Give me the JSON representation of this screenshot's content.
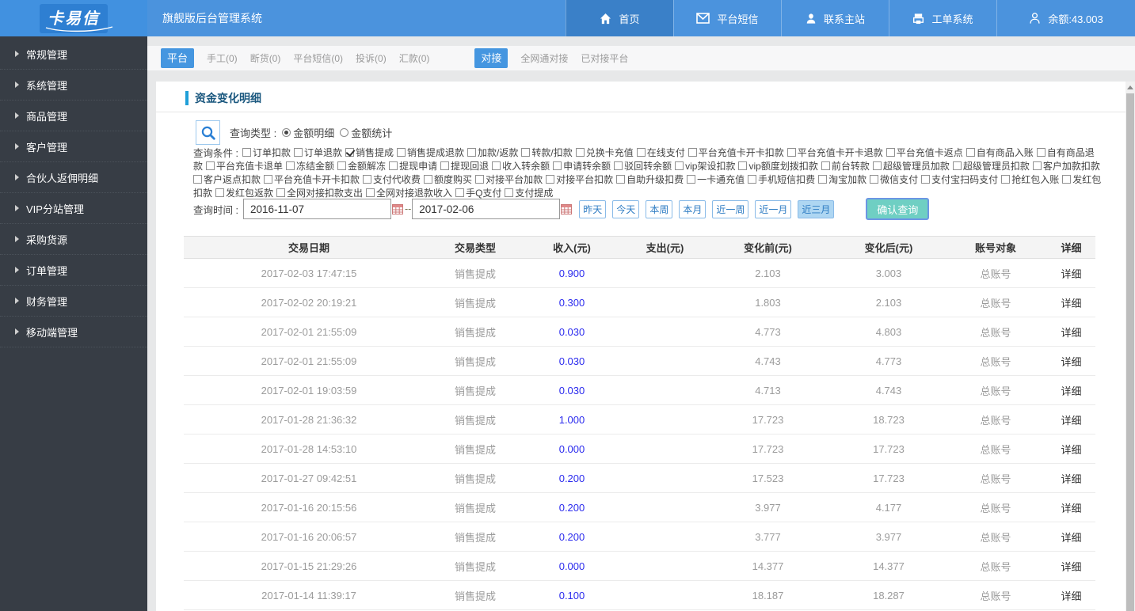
{
  "header": {
    "logo": "卡易信",
    "title": "旗舰版后台管理系统",
    "nav": [
      {
        "label": "首页",
        "icon": "home-icon",
        "active": true
      },
      {
        "label": "平台短信",
        "icon": "sms-icon",
        "active": false
      },
      {
        "label": "联系主站",
        "icon": "contact-icon",
        "active": false
      },
      {
        "label": "工单系统",
        "icon": "ticket-icon",
        "active": false
      },
      {
        "label": "余额:43.003",
        "icon": "user-icon",
        "active": false
      }
    ]
  },
  "sidebar": {
    "items": [
      "常规管理",
      "系统管理",
      "商品管理",
      "客户管理",
      "合伙人返佣明细",
      "VIP分站管理",
      "采购货源",
      "订单管理",
      "财务管理",
      "移动端管理"
    ]
  },
  "subnav": {
    "platform_label": "平台",
    "platform_tabs": [
      "手工(0)",
      "断货(0)",
      "平台短信(0)",
      "投诉(0)",
      "汇款(0)"
    ],
    "connect_label": "对接",
    "connect_tabs": [
      "全网通对接",
      "已对接平台"
    ]
  },
  "content": {
    "title": "资金变化明细",
    "query_type": {
      "label": "查询类型 :",
      "options": [
        {
          "label": "金额明细",
          "selected": true
        },
        {
          "label": "金额统计",
          "selected": false
        }
      ]
    },
    "cond_label": "查询条件 :",
    "filter_lines": [
      [
        {
          "cb": "订单扣款"
        },
        {
          "cb": "订单退款"
        },
        {
          "cb": "销售提成",
          "checked": true
        },
        {
          "cb": "销售提成退款"
        },
        {
          "cb": "加款/返款"
        },
        {
          "cb": "转款/扣款"
        },
        {
          "cb": "兑换卡充值"
        },
        {
          "cb": "在线支付"
        },
        {
          "cb": "平台充值卡开卡扣款"
        },
        {
          "cb": "平台充值卡开卡退款"
        },
        {
          "cb": "平台充值卡返点"
        },
        {
          "cb": "自有商品入账"
        },
        {
          "cb": "自有商品退"
        }
      ],
      [
        {
          "t": "款"
        },
        {
          "cb": "平台充值卡退单"
        },
        {
          "cb": "冻结金额"
        },
        {
          "cb": "金额解冻"
        },
        {
          "cb": "提现申请"
        },
        {
          "cb": "提现回退"
        },
        {
          "cb": "收入转余额"
        },
        {
          "cb": "申请转余额"
        },
        {
          "cb": "驳回转余额"
        },
        {
          "cb": "vip架设扣款"
        },
        {
          "cb": "vip额度划拨扣款"
        },
        {
          "cb": "前台转款"
        },
        {
          "cb": "超级管理员加款"
        },
        {
          "cb": "超级管理员扣款"
        },
        {
          "cb": "客户加款扣款"
        }
      ],
      [
        {
          "cb": "客户返点扣款"
        },
        {
          "cb": "平台充值卡开卡扣款"
        },
        {
          "cb": "支付代收费"
        },
        {
          "cb": "额度购买"
        },
        {
          "cb": "对接平台加款"
        },
        {
          "cb": "对接平台扣款"
        },
        {
          "cb": "自助升级扣费"
        },
        {
          "cb": "一卡通充值"
        },
        {
          "cb": "手机短信扣费"
        },
        {
          "cb": "淘宝加款"
        },
        {
          "cb": "微信支付"
        },
        {
          "cb": "支付宝扫码支付"
        },
        {
          "cb": "抢红包入账"
        },
        {
          "cb": "发红包"
        }
      ],
      [
        {
          "t": "扣款"
        },
        {
          "cb": "发红包返款"
        },
        {
          "cb": "全网对接扣款支出"
        },
        {
          "cb": "全网对接退款收入"
        },
        {
          "cb": "手Q支付"
        },
        {
          "cb": "支付提成"
        }
      ]
    ],
    "time": {
      "label": "查询时间 :",
      "from": "2016-11-07",
      "to": "2017-02-06",
      "separator": "--"
    },
    "quick_buttons": [
      {
        "label": "昨天",
        "active": false
      },
      {
        "label": "今天",
        "active": false
      },
      {
        "label": "本周",
        "active": false
      },
      {
        "label": "本月",
        "active": false
      },
      {
        "label": "近一周",
        "active": false
      },
      {
        "label": "近一月",
        "active": false
      },
      {
        "label": "近三月",
        "active": true
      }
    ],
    "submit_label": "确认查询"
  },
  "table": {
    "headers": [
      "交易日期",
      "交易类型",
      "收入(元)",
      "支出(元)",
      "变化前(元)",
      "变化后(元)",
      "账号对象",
      "详细"
    ],
    "rows": [
      [
        "2017-02-03 17:47:15",
        "销售提成",
        "0.900",
        "",
        "2.103",
        "3.003",
        "总账号",
        "详细"
      ],
      [
        "2017-02-02 20:19:21",
        "销售提成",
        "0.300",
        "",
        "1.803",
        "2.103",
        "总账号",
        "详细"
      ],
      [
        "2017-02-01 21:55:09",
        "销售提成",
        "0.030",
        "",
        "4.773",
        "4.803",
        "总账号",
        "详细"
      ],
      [
        "2017-02-01 21:55:09",
        "销售提成",
        "0.030",
        "",
        "4.743",
        "4.773",
        "总账号",
        "详细"
      ],
      [
        "2017-02-01 19:03:59",
        "销售提成",
        "0.030",
        "",
        "4.713",
        "4.743",
        "总账号",
        "详细"
      ],
      [
        "2017-01-28 21:36:32",
        "销售提成",
        "1.000",
        "",
        "17.723",
        "18.723",
        "总账号",
        "详细"
      ],
      [
        "2017-01-28 14:53:10",
        "销售提成",
        "0.000",
        "",
        "17.723",
        "17.723",
        "总账号",
        "详细"
      ],
      [
        "2017-01-27 09:42:51",
        "销售提成",
        "0.200",
        "",
        "17.523",
        "17.723",
        "总账号",
        "详细"
      ],
      [
        "2017-01-16 20:15:56",
        "销售提成",
        "0.200",
        "",
        "3.977",
        "4.177",
        "总账号",
        "详细"
      ],
      [
        "2017-01-16 20:06:57",
        "销售提成",
        "0.200",
        "",
        "3.777",
        "3.977",
        "总账号",
        "详细"
      ],
      [
        "2017-01-15 21:29:26",
        "销售提成",
        "0.000",
        "",
        "14.377",
        "14.377",
        "总账号",
        "详细"
      ],
      [
        "2017-01-14 11:39:17",
        "销售提成",
        "0.100",
        "",
        "18.187",
        "18.287",
        "总账号",
        "详细"
      ]
    ]
  }
}
